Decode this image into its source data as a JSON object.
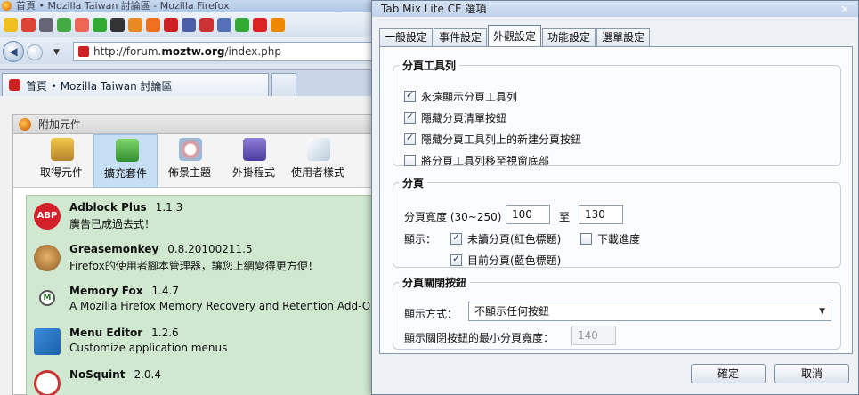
{
  "firefox": {
    "window_title": "首頁 • Mozilla Taiwan 討論區 - Mozilla Firefox",
    "url_prefix": "http://forum.",
    "url_domain": "moztw.org",
    "url_suffix": "/index.php",
    "tab_title": "首頁 • Mozilla Taiwan 討論區",
    "addons": {
      "title": "附加元件",
      "tabs": [
        {
          "label": "取得元件",
          "icon": "get-addons-icon"
        },
        {
          "label": "擴充套件",
          "icon": "extensions-icon"
        },
        {
          "label": "佈景主題",
          "icon": "themes-icon"
        },
        {
          "label": "外掛程式",
          "icon": "plugins-icon"
        },
        {
          "label": "使用者樣式",
          "icon": "user-styles-icon"
        }
      ],
      "selected_tab": "擴充套件",
      "extensions": [
        {
          "name": "Adblock Plus",
          "version": "1.1.3",
          "desc": "廣告已成過去式！",
          "icon_text": "ABP"
        },
        {
          "name": "Greasemonkey",
          "version": "0.8.20100211.5",
          "desc": "Firefox的使用者腳本管理器，讓您上網變得更方便！"
        },
        {
          "name": "Memory Fox",
          "version": "1.4.7",
          "desc": "A Mozilla Firefox Memory Recovery and Retention Add-On",
          "icon_text": "M"
        },
        {
          "name": "Menu Editor",
          "version": "1.2.6",
          "desc": "Customize application menus"
        },
        {
          "name": "NoSquint",
          "version": "2.0.4",
          "desc": ""
        }
      ]
    }
  },
  "dialog": {
    "title": "Tab Mix Lite CE 選項",
    "close": "×",
    "tabs": [
      "一般設定",
      "事件設定",
      "外觀設定",
      "功能設定",
      "選單設定"
    ],
    "selected_tab": "外觀設定",
    "tabbar_group": {
      "legend": "分頁工具列",
      "options": [
        {
          "label": "永遠顯示分頁工具列",
          "checked": true
        },
        {
          "label": "隱藏分頁清單按鈕",
          "checked": true
        },
        {
          "label": "隱藏分頁工具列上的新建分頁按鈕",
          "checked": true
        },
        {
          "label": "將分頁工具列移至視窗底部",
          "checked": false
        }
      ]
    },
    "tab_group": {
      "legend": "分頁",
      "width_label": "分頁寬度 (30~250)",
      "width_min": "100",
      "to_label": "至",
      "width_max": "130",
      "show_label": "顯示：",
      "unread": {
        "label": "未讀分頁(紅色標題)",
        "checked": true
      },
      "progress": {
        "label": "下載進度",
        "checked": false
      },
      "current": {
        "label": "目前分頁(藍色標題)",
        "checked": true
      }
    },
    "close_group": {
      "legend": "分頁關閉按鈕",
      "mode_label": "顯示方式：",
      "mode_value": "不顯示任何按鈕",
      "minwidth_label": "顯示關閉按鈕的最小分頁寬度：",
      "minwidth_value": "140"
    },
    "ok_label": "確定",
    "cancel_label": "取消"
  }
}
